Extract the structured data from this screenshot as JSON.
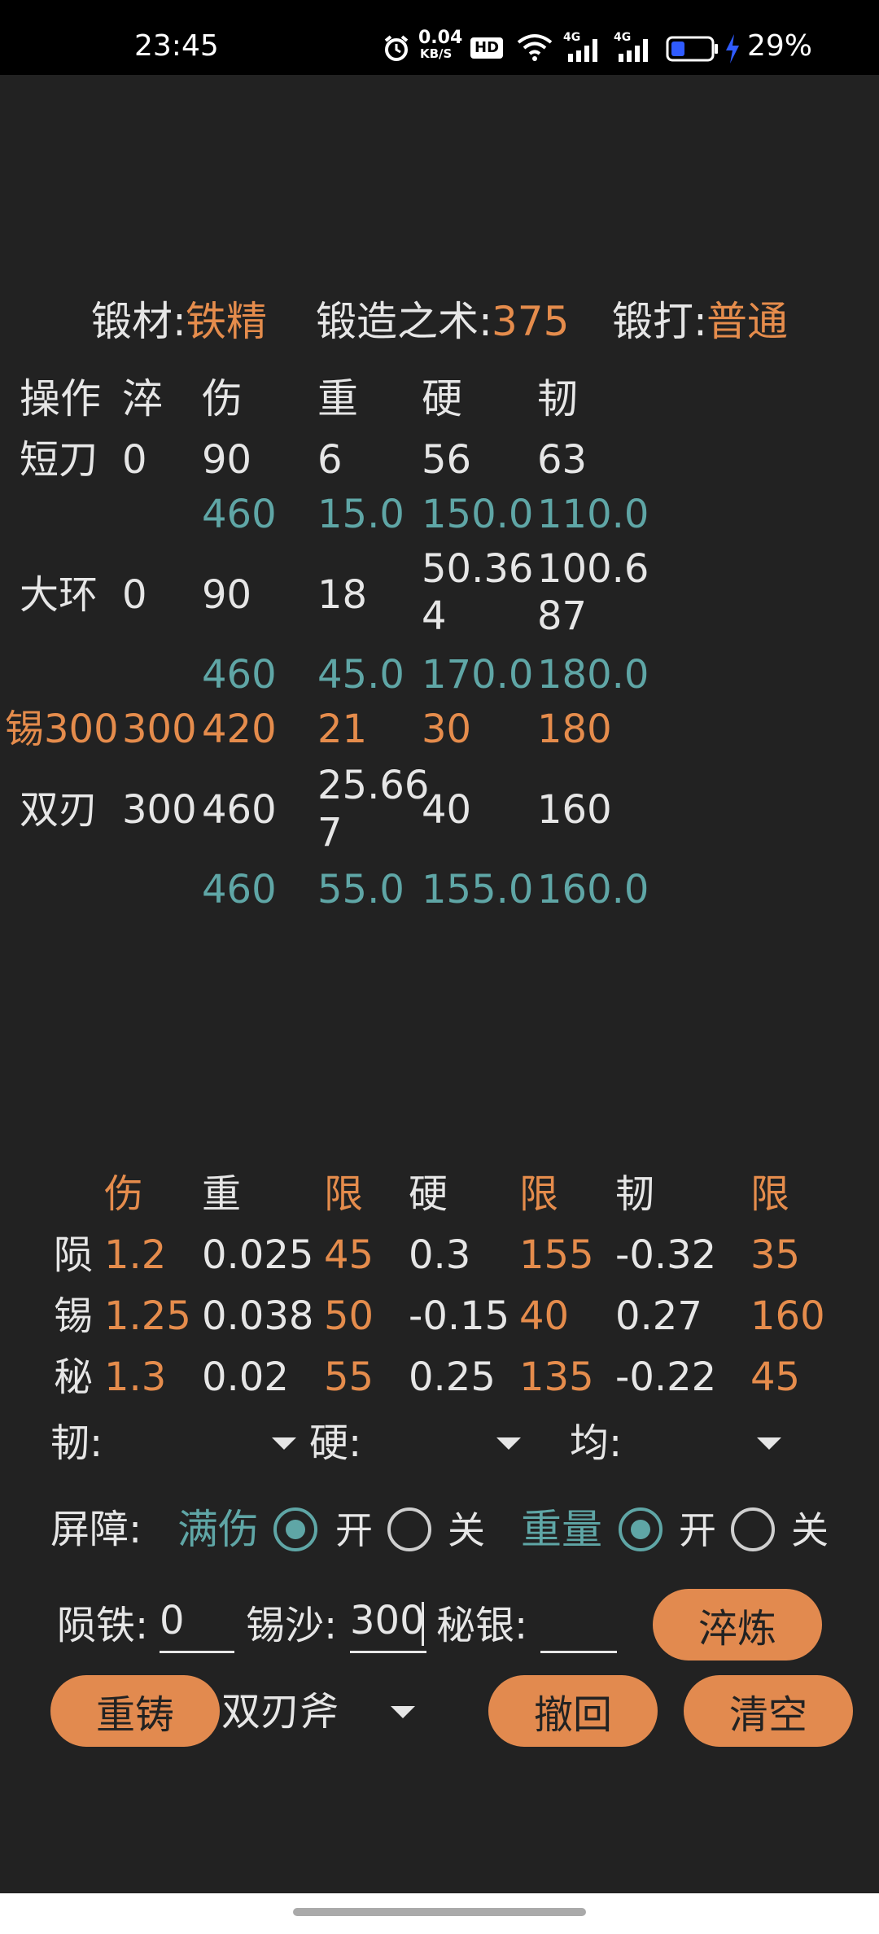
{
  "status_bar": {
    "time": "23:45",
    "net_speed": "0.04",
    "net_unit": "KB/S",
    "hd": "HD",
    "sig1": "4G",
    "sig2": "4G",
    "battery": "29%"
  },
  "header": {
    "material_label": "锻材:",
    "material_value": "铁精",
    "skill_label": "锻造之术:",
    "skill_value": "375",
    "forge_label": "锻打:",
    "forge_value": "普通"
  },
  "table": {
    "headers": [
      "操作",
      "淬",
      "伤",
      "重",
      "硬",
      "韧"
    ],
    "rows": [
      {
        "name": "短刀",
        "quench": "0",
        "dmg": "90",
        "wt": "6",
        "hard": "56",
        "tough": "63"
      },
      {
        "name": "",
        "quench": "",
        "dmg": "460",
        "wt": "15.0",
        "hard": "150.0",
        "tough": "110.0"
      },
      {
        "name": "大环",
        "quench": "0",
        "dmg": "90",
        "wt": "18",
        "hard_l1": "50.36",
        "hard_l2": "4",
        "tough_l1": "100.6",
        "tough_l2": "87"
      },
      {
        "name": "",
        "quench": "",
        "dmg": "460",
        "wt": "45.0",
        "hard": "170.0",
        "tough": "180.0"
      },
      {
        "name": "锡300",
        "quench": "300",
        "dmg": "420",
        "wt": "21",
        "hard": "30",
        "tough": "180"
      },
      {
        "name": "双刃",
        "quench": "300",
        "dmg": "460",
        "wt_l1": "25.66",
        "wt_l2": "7",
        "hard": "40",
        "tough": "160"
      },
      {
        "name": "",
        "quench": "",
        "dmg": "460",
        "wt": "55.0",
        "hard": "155.0",
        "tough": "160.0"
      }
    ]
  },
  "coef": {
    "headers": [
      "伤",
      "重",
      "限",
      "硬",
      "限",
      "韧",
      "限"
    ],
    "rows": [
      {
        "label": "陨",
        "v": [
          "1.2",
          "0.025",
          "45",
          "0.3",
          "155",
          "-0.32",
          "35"
        ]
      },
      {
        "label": "锡",
        "v": [
          "1.25",
          "0.038",
          "50",
          "-0.15",
          "40",
          "0.27",
          "160"
        ]
      },
      {
        "label": "秘",
        "v": [
          "1.3",
          "0.02",
          "55",
          "0.25",
          "135",
          "-0.22",
          "45"
        ]
      }
    ]
  },
  "selects": {
    "tough_label": "韧:",
    "hard_label": "硬:",
    "avg_label": "均:"
  },
  "toggles": {
    "barrier_label": "屏障:",
    "full_damage_label": "满伤",
    "full_on": "开",
    "full_off": "关",
    "weight_label": "重量",
    "weight_on": "开",
    "weight_off": "关"
  },
  "inputs": {
    "meteor_label": "陨铁:",
    "meteor_value": "0",
    "tin_label": "锡沙:",
    "tin_value": "300",
    "silver_label": "秘银:",
    "silver_value": ""
  },
  "buttons": {
    "quench": "淬炼",
    "recast": "重铸",
    "undo": "撤回",
    "clear": "清空"
  },
  "weapon_select": {
    "value": "双刃斧"
  }
}
